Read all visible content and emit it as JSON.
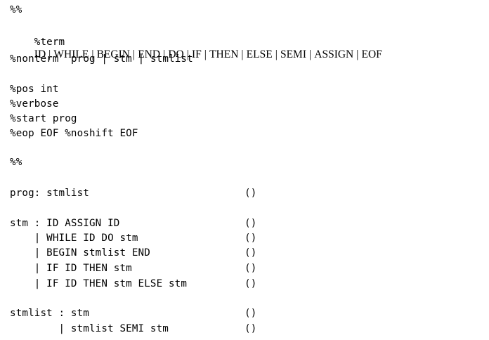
{
  "header": {
    "sep1": "%%",
    "term_directive": "%term",
    "terms": [
      "ID",
      "WHILE",
      "BEGIN",
      "END",
      "DO",
      "IF",
      "THEN",
      "ELSE",
      "SEMI",
      "ASSIGN",
      "EOF"
    ],
    "nonterm_directive": "%nonterm",
    "nonterms": [
      "prog",
      "stm",
      "stmlist"
    ],
    "pos": "%pos int",
    "verbose": "%verbose",
    "start": "%start prog",
    "eop": "%eop EOF %noshift EOF",
    "sep2": "%%"
  },
  "rules": [
    {
      "lhs": "prog: stmlist",
      "action": "()"
    },
    {
      "lhs": "stm : ID ASSIGN ID",
      "action": "()"
    },
    {
      "lhs": "    | WHILE ID DO stm",
      "action": "()"
    },
    {
      "lhs": "    | BEGIN stmlist END",
      "action": "()"
    },
    {
      "lhs": "    | IF ID THEN stm",
      "action": "()"
    },
    {
      "lhs": "    | IF ID THEN stm ELSE stm",
      "action": "()"
    },
    {
      "lhs": "stmlist : stm",
      "action": "()"
    },
    {
      "lhs": "        | stmlist SEMI stm",
      "action": "()"
    }
  ]
}
